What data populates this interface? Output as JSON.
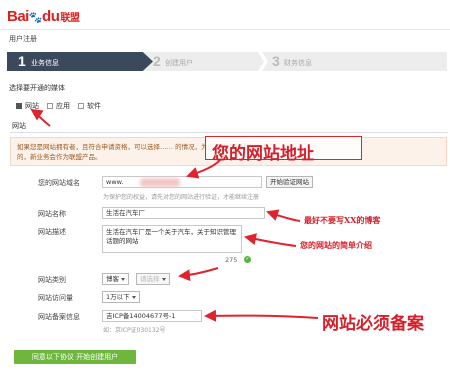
{
  "brand": {
    "logo_text": "Bai",
    "logo_paw": "🐾",
    "logo_du": "du",
    "logo_cn": "联盟"
  },
  "page": {
    "title": "用户注册"
  },
  "steps": [
    {
      "num": "1",
      "label": "业务信息"
    },
    {
      "num": "2",
      "label": "创建用户"
    },
    {
      "num": "3",
      "label": "财务信息"
    }
  ],
  "media": {
    "title": "选择要开通的媒体",
    "options": [
      {
        "label": "网站",
        "checked": true
      },
      {
        "label": "应用",
        "checked": false
      },
      {
        "label": "软件",
        "checked": false
      }
    ]
  },
  "site_section": {
    "title": "网站"
  },
  "notice": {
    "line1": "如果您是网站拥有者，且符合申请资格，可以选择……                                                        的情况，为您选择性开通网盟推广",
    "line2": "的，新业务会作为联盟产品。"
  },
  "form": {
    "domain": {
      "label": "您的网站域名",
      "value": "www.",
      "button": "开始验证网站",
      "hint": "为保护您的权益，请先对您的网站进行验证，才能继续注册"
    },
    "name": {
      "label": "网站名称",
      "value": "生活在汽车厂"
    },
    "desc": {
      "label": "网站描述",
      "value": "生活在汽车厂是一个关于汽车，关于知识管理话题的网站",
      "counter": "275"
    },
    "category": {
      "label": "网站类别",
      "value": "博客",
      "sub_placeholder": "请选择"
    },
    "traffic": {
      "label": "网站访问量",
      "value": "1万以下"
    },
    "icp": {
      "label": "网站备案信息",
      "value": "吉ICP备14004677号-1",
      "hint": "如：京ICP证030132号"
    }
  },
  "submit": {
    "label": "同意以下协议 开始创建用户"
  },
  "annotations": {
    "site_addr": "您的网站地址",
    "no_xx_blog": "最好不要写XX的博客",
    "brief_intro": "您的网站的简单介绍",
    "must_record": "网站必须备案"
  },
  "colors": {
    "accent_red": "#d51f2a",
    "step_active": "#3a4a5c",
    "submit_green": "#6fb63d"
  }
}
